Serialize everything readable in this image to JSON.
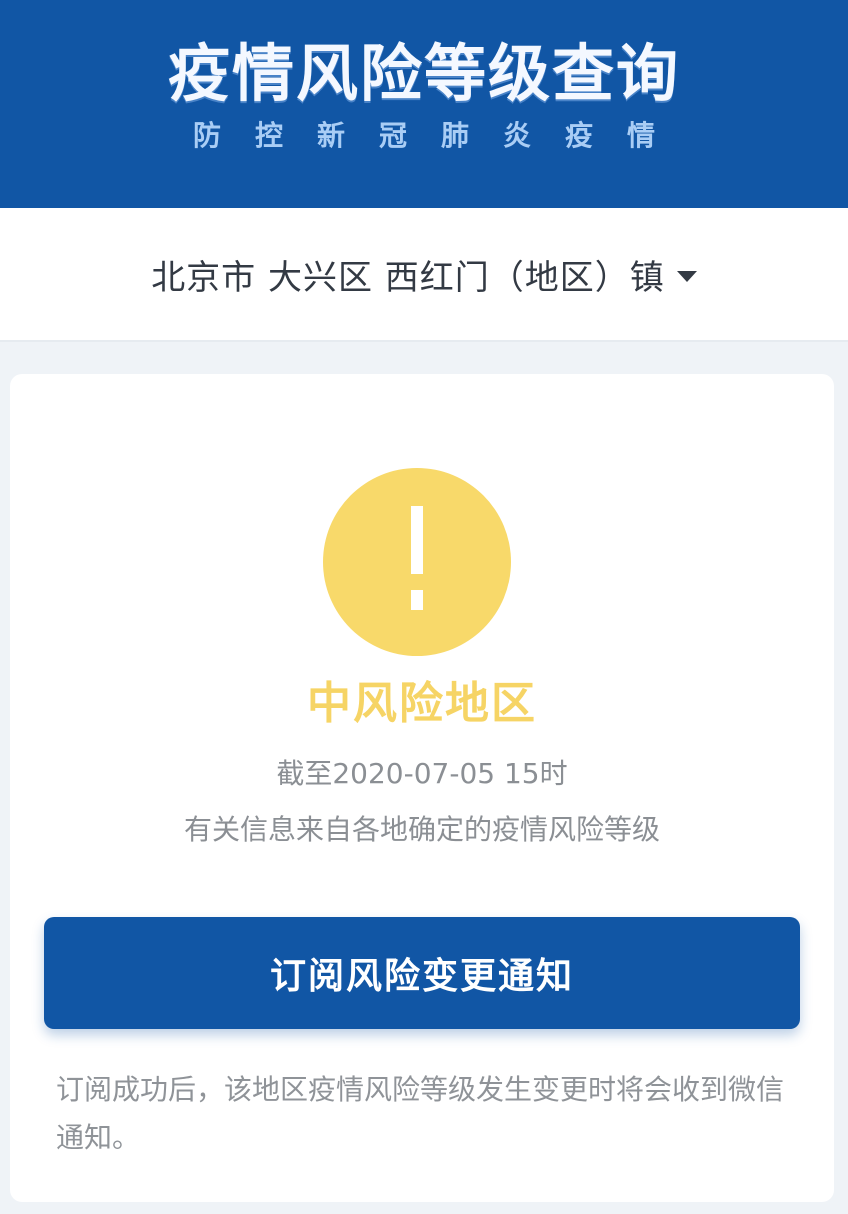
{
  "header": {
    "title": "疫情风险等级查询",
    "subtitle": "防控新冠肺炎疫情"
  },
  "location": {
    "label": "北京市 大兴区 西红门（地区）镇",
    "dropdown_icon": "caret-down-icon"
  },
  "result": {
    "icon": "exclamation-icon",
    "risk_level": "中风险地区",
    "as_of": "截至2020-07-05 15时",
    "source_note": "有关信息来自各地确定的疫情风险等级"
  },
  "subscribe": {
    "button_label": "订阅风险变更通知",
    "note": "订阅成功后，该地区疫情风险等级发生变更时将会收到微信通知。"
  },
  "colors": {
    "header_bg": "#1156a5",
    "warning_yellow": "#f8d96a",
    "page_bg": "#eff3f7"
  }
}
